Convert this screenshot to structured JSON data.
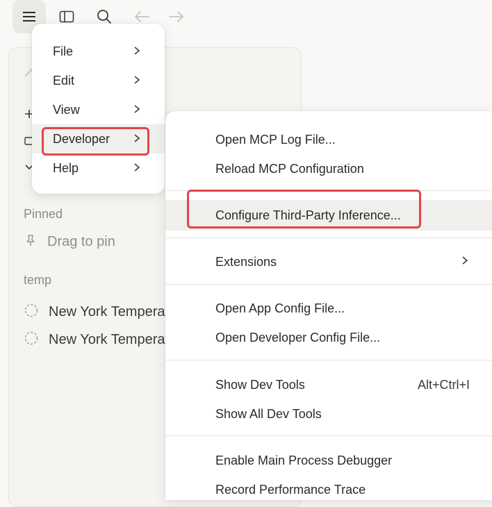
{
  "toolbar": {
    "icons": [
      "hamburger-menu-icon",
      "sidebar-toggle-icon",
      "search-icon",
      "arrow-left-icon",
      "arrow-right-icon"
    ]
  },
  "sidebar": {
    "pinned_label": "Pinned",
    "drag_to_pin": "Drag to pin",
    "temp_label": "temp",
    "chats": [
      {
        "title": "New York Temperature"
      },
      {
        "title": "New York Temperature"
      }
    ]
  },
  "main_menu": {
    "items": [
      {
        "label": "File"
      },
      {
        "label": "Edit"
      },
      {
        "label": "View"
      },
      {
        "label": "Developer"
      },
      {
        "label": "Help"
      }
    ]
  },
  "developer_menu": {
    "items": [
      {
        "label": "Open MCP Log File..."
      },
      {
        "label": "Reload MCP Configuration"
      },
      {
        "label": "Configure Third-Party Inference..."
      },
      {
        "label": "Extensions"
      },
      {
        "label": "Open App Config File..."
      },
      {
        "label": "Open Developer Config File..."
      },
      {
        "label": "Show Dev Tools",
        "shortcut": "Alt+Ctrl+I"
      },
      {
        "label": "Show All Dev Tools"
      },
      {
        "label": "Enable Main Process Debugger"
      },
      {
        "label": "Record Performance Trace"
      }
    ]
  },
  "colors": {
    "highlight": "#e0454a",
    "background": "#f8f8f6",
    "menu_bg": "#ffffff"
  }
}
